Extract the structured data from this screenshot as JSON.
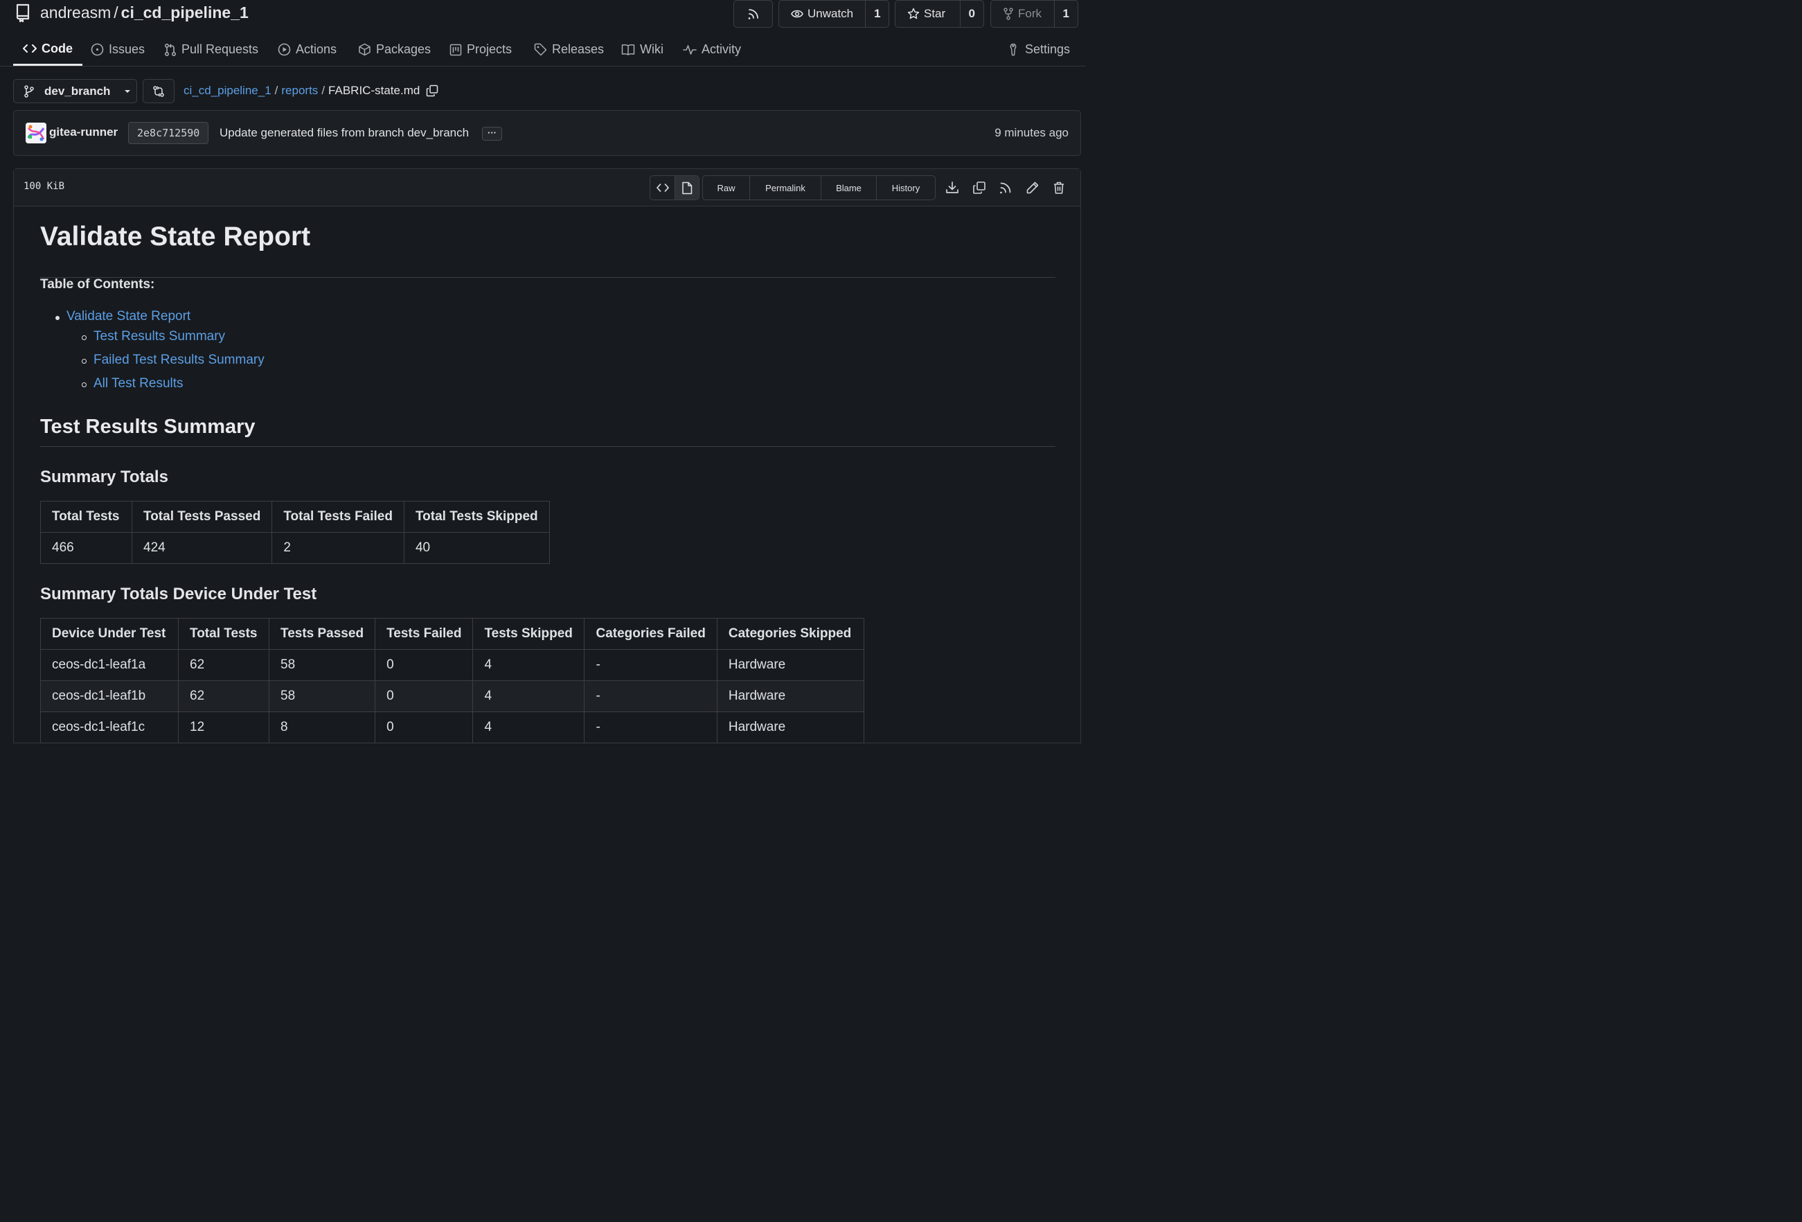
{
  "repo": {
    "owner": "andreasm",
    "name": "ci_cd_pipeline_1"
  },
  "header": {
    "watch": {
      "label": "Unwatch",
      "count": "1"
    },
    "star": {
      "label": "Star",
      "count": "0"
    },
    "fork": {
      "label": "Fork",
      "count": "1"
    }
  },
  "tabs": [
    {
      "label": "Code",
      "icon": "code-icon"
    },
    {
      "label": "Issues",
      "icon": "issue-icon"
    },
    {
      "label": "Pull Requests",
      "icon": "pull-request-icon"
    },
    {
      "label": "Actions",
      "icon": "play-icon"
    },
    {
      "label": "Packages",
      "icon": "package-icon"
    },
    {
      "label": "Projects",
      "icon": "project-icon"
    },
    {
      "label": "Releases",
      "icon": "tag-icon"
    },
    {
      "label": "Wiki",
      "icon": "book-icon"
    },
    {
      "label": "Activity",
      "icon": "pulse-icon"
    },
    {
      "label": "Settings",
      "icon": "tools-icon"
    }
  ],
  "branch": {
    "name": "dev_branch"
  },
  "breadcrumb": {
    "repo": "ci_cd_pipeline_1",
    "folder": "reports",
    "file": "FABRIC-state.md"
  },
  "commit": {
    "author": "gitea-runner",
    "sha": "2e8c712590",
    "message": "Update generated files from branch dev_branch",
    "ellipsis": "···",
    "time": "9 minutes ago"
  },
  "file": {
    "size": "100 KiB",
    "actions": [
      "Raw",
      "Permalink",
      "Blame",
      "History"
    ]
  },
  "doc": {
    "title": "Validate State Report",
    "toc_title": "Table of Contents:",
    "toc": {
      "top": "Validate State Report",
      "children": [
        "Test Results Summary",
        "Failed Test Results Summary",
        "All Test Results"
      ]
    },
    "section_title": "Test Results Summary",
    "summary_totals": {
      "title": "Summary Totals",
      "headers": [
        "Total Tests",
        "Total Tests Passed",
        "Total Tests Failed",
        "Total Tests Skipped"
      ],
      "rows": [
        [
          "466",
          "424",
          "2",
          "40"
        ]
      ]
    },
    "summary_dut": {
      "title": "Summary Totals Device Under Test",
      "headers": [
        "Device Under Test",
        "Total Tests",
        "Tests Passed",
        "Tests Failed",
        "Tests Skipped",
        "Categories Failed",
        "Categories Skipped"
      ],
      "rows": [
        [
          "ceos-dc1-leaf1a",
          "62",
          "58",
          "0",
          "4",
          "-",
          "Hardware"
        ],
        [
          "ceos-dc1-leaf1b",
          "62",
          "58",
          "0",
          "4",
          "-",
          "Hardware"
        ],
        [
          "ceos-dc1-leaf1c",
          "12",
          "8",
          "0",
          "4",
          "-",
          "Hardware"
        ]
      ]
    }
  }
}
